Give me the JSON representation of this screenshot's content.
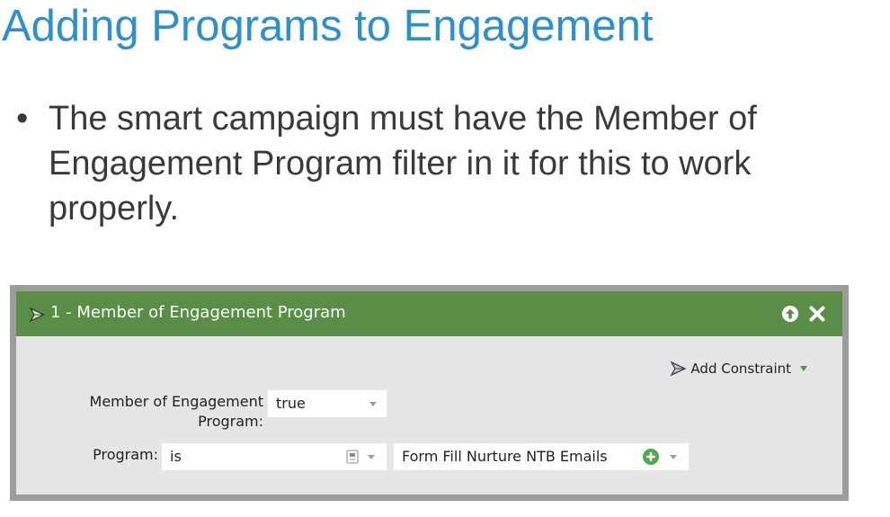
{
  "slide": {
    "title": "Adding Programs to Engagement",
    "bullet": "The smart campaign must have the Member of Engagement Program filter in it for this to work properly.",
    "bullet_marker": "•"
  },
  "filter_panel": {
    "title": "1 - Member of Engagement Program",
    "header_color": "#5a8e47",
    "add_constraint_label": "Add Constraint",
    "rows": [
      {
        "label_line1": "Member of Engagement",
        "label_line2": "Program:",
        "value": "true"
      },
      {
        "label": "Program:",
        "operator": "is",
        "value": "Form Fill Nurture NTB Emails"
      }
    ]
  },
  "colors": {
    "title": "#2e8fcd",
    "body_text": "#3a3a3a",
    "frame": "#9c9c9c",
    "panel_bg": "#e6e6e6"
  }
}
